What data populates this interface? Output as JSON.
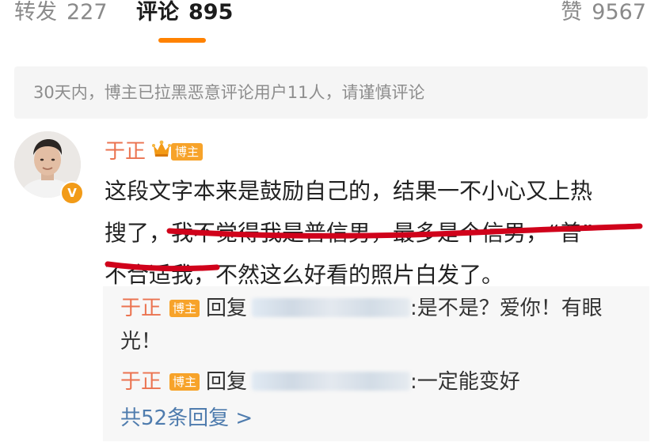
{
  "tabs": {
    "repost": {
      "label": "转发",
      "count": "227"
    },
    "comment": {
      "label": "评论",
      "count": "895"
    },
    "like": {
      "label": "赞",
      "count": "9567"
    }
  },
  "notice": "30天内，博主已拉黑恶意评论用户11人，请谨慎评论",
  "comment": {
    "author": "于正",
    "tag": "博主",
    "verified_badge": "V",
    "lines": [
      "这段文字本来是鼓励自己的，结果一不小心又上热",
      "搜了，我不觉得我是普信男，最多是个信男，“普”",
      "不合适我，不然这么好看的照片白发了。"
    ]
  },
  "replies": [
    {
      "name": "于正",
      "tag": "博主",
      "verb": "回复",
      "text_line1": ":是不是？爱你！有眼",
      "text_line2": "光！"
    },
    {
      "name": "于正",
      "tag": "博主",
      "verb": "回复",
      "text_line1": ":一定能变好"
    }
  ],
  "more_replies": "共52条回复 >",
  "colors": {
    "accent": "#ff8200",
    "author": "#eb7350",
    "tag": "#f7a32a",
    "link": "#4f7cae",
    "annotation_red": "#d0021b"
  },
  "icons": [
    "crown-icon",
    "verified-v-icon",
    "avatar-photo"
  ]
}
